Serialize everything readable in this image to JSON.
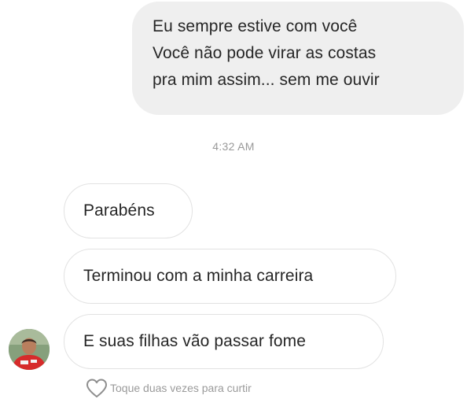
{
  "thread": {
    "sent_message": {
      "lines": [
        "Eu sempre estive com você",
        "Você não pode virar as costas",
        "pra mim assim... sem me ouvir"
      ]
    },
    "timestamp": "4:32 AM",
    "received_messages": [
      {
        "text": "Parabéns"
      },
      {
        "text": "Terminou com a minha carreira"
      },
      {
        "text": "E suas filhas vão passar fome"
      }
    ],
    "like_hint": {
      "icon": "heart-outline-icon",
      "text": "Toque duas vezes para curtir"
    }
  },
  "colors": {
    "sent_bubble": "#efefef",
    "received_border": "#e2e2e2",
    "meta_text": "#999999",
    "message_text": "#262626"
  }
}
